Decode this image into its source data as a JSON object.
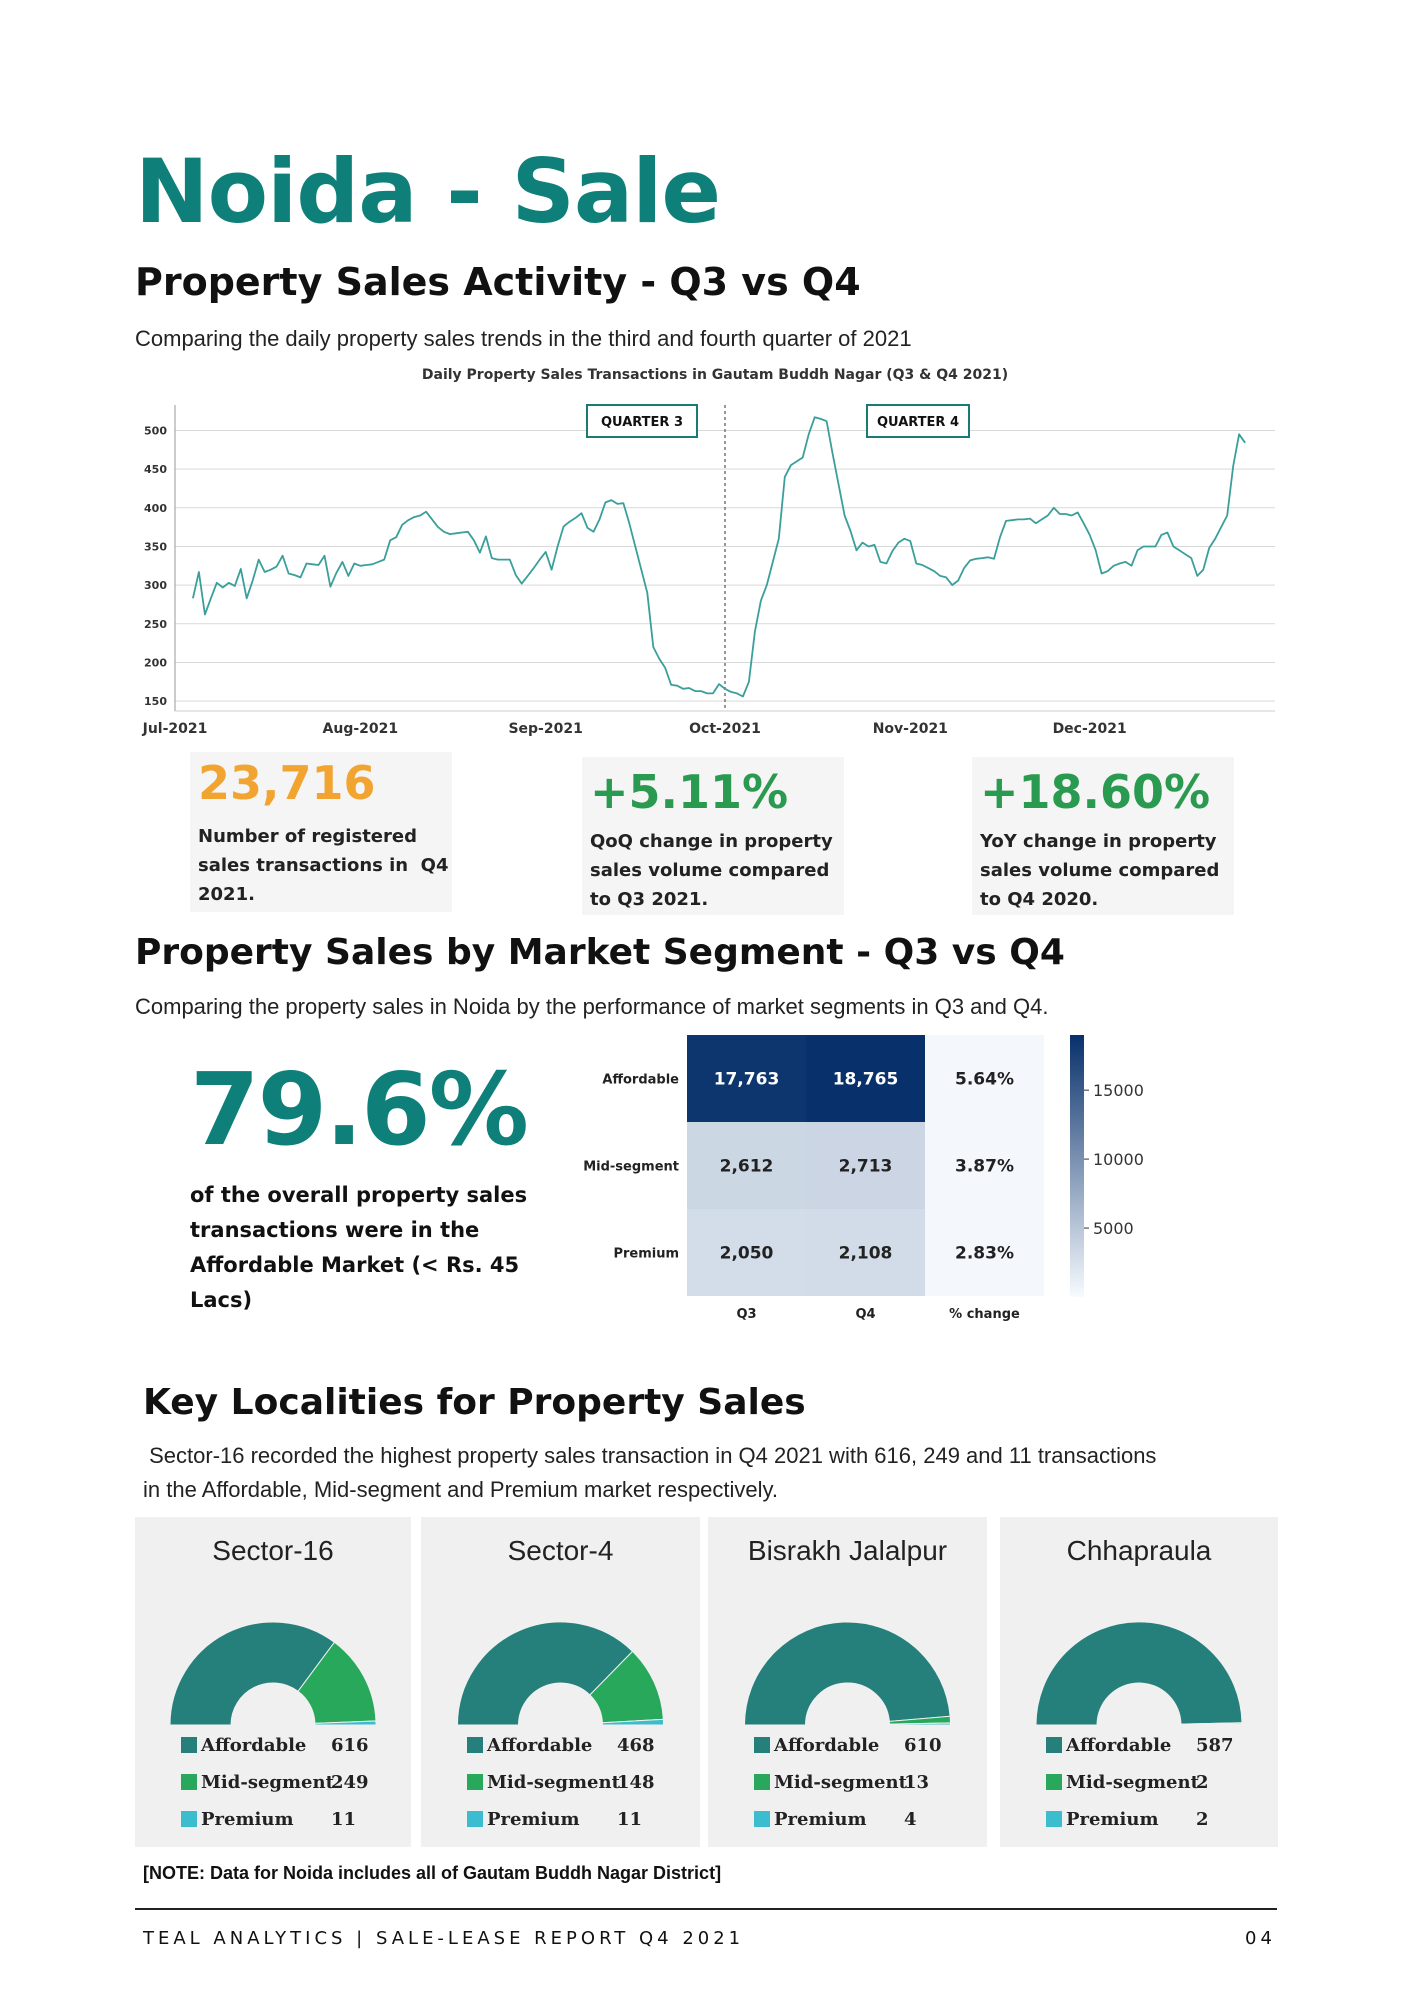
{
  "page": {
    "title": "Noida - Sale",
    "footer_left": "TEAL ANALYTICS | SALE-LEASE REPORT Q4 2021",
    "footer_right": "04",
    "note": "[NOTE: Data for Noida includes all of Gautam Buddh Nagar District]"
  },
  "colors": {
    "teal": "#0e8079",
    "orange": "#f2a431",
    "green": "#2a9a50",
    "line": "#3a9f9a"
  },
  "section1": {
    "heading": "Property Sales Activity - Q3 vs Q4",
    "subtitle": "Comparing the daily property sales trends in the third and fourth quarter of 2021"
  },
  "chart_data": [
    {
      "type": "line",
      "title": "Daily Property Sales Transactions in Gautam Buddh Nagar (Q3 & Q4 2021)",
      "xlabel": "",
      "ylabel": "",
      "x_ticks": [
        "Jul-2021",
        "Aug-2021",
        "Sep-2021",
        "Oct-2021",
        "Nov-2021",
        "Dec-2021"
      ],
      "y_ticks": [
        150,
        200,
        250,
        300,
        350,
        400,
        450,
        500
      ],
      "ylim": [
        145,
        520
      ],
      "grid": true,
      "annotations": [
        "QUARTER 3",
        "QUARTER 4"
      ],
      "divider_x": 92,
      "x": [
        3,
        4,
        5,
        6,
        7,
        8,
        9,
        10,
        11,
        12,
        13,
        14,
        15,
        16,
        17,
        18,
        19,
        20,
        21,
        22,
        23,
        24,
        25,
        26,
        27,
        28,
        29,
        30,
        31,
        32,
        33,
        34,
        35,
        36,
        37,
        38,
        39,
        40,
        41,
        42,
        43,
        44,
        45,
        46,
        47,
        48,
        49,
        50,
        51,
        52,
        53,
        54,
        55,
        56,
        57,
        58,
        59,
        60,
        61,
        62,
        63,
        64,
        65,
        66,
        67,
        68,
        69,
        70,
        71,
        72,
        73,
        74,
        75,
        76,
        77,
        78,
        79,
        80,
        81,
        82,
        83,
        84,
        85,
        86,
        87,
        88,
        89,
        90,
        91,
        92,
        93,
        94,
        95,
        96,
        97,
        98,
        99,
        100,
        101,
        102,
        103,
        104,
        105,
        106,
        107,
        108,
        109,
        110,
        111,
        112,
        113,
        114,
        115,
        116,
        117,
        118,
        119,
        120,
        121,
        122,
        123,
        124,
        125,
        126,
        127,
        128,
        129,
        130,
        131,
        132,
        133,
        134,
        135,
        136,
        137,
        138,
        139,
        140,
        141,
        142,
        143,
        144,
        145,
        146,
        147,
        148,
        149,
        150,
        151,
        152,
        153,
        154,
        155,
        156,
        157,
        158,
        159,
        160,
        161,
        162,
        163,
        164,
        165,
        166,
        167,
        168,
        169,
        170,
        171,
        172,
        173,
        174,
        175,
        176,
        177,
        178,
        179,
        180,
        181,
        182,
        183,
        184
      ],
      "series": [
        {
          "values": [
            283,
            317,
            262,
            283,
            303,
            297,
            303,
            299,
            321,
            283,
            306,
            333,
            317,
            320,
            324,
            338,
            315,
            313,
            310,
            328,
            327,
            326,
            338,
            298,
            316,
            330,
            312,
            328,
            325,
            326,
            327,
            330,
            333,
            358,
            362,
            378,
            384,
            388,
            390,
            395,
            385,
            375,
            369,
            366,
            367,
            368,
            369,
            358,
            342,
            363,
            335,
            333,
            333,
            333,
            313,
            302,
            312,
            322,
            333,
            343,
            320,
            350,
            376,
            382,
            387,
            393,
            374,
            369,
            385,
            407,
            410,
            405,
            406,
            380,
            350,
            320,
            290,
            220,
            205,
            193,
            171,
            170,
            166,
            167,
            163,
            163,
            160,
            160,
            172,
            166,
            162,
            160,
            156,
            175,
            240,
            280,
            300,
            330,
            360,
            440,
            455,
            460,
            465,
            495,
            517,
            515,
            512,
            470,
            430,
            390,
            370,
            345,
            355,
            350,
            352,
            330,
            328,
            344,
            355,
            360,
            357,
            328,
            326,
            322,
            318,
            312,
            310,
            300,
            306,
            322,
            332,
            334,
            335,
            336,
            334,
            362,
            383,
            384,
            385,
            385,
            386,
            380,
            385,
            390,
            400,
            392,
            392,
            390,
            394,
            380,
            365,
            345,
            315,
            318,
            325,
            328,
            330,
            325,
            345,
            350,
            350,
            350,
            365,
            368,
            350,
            345,
            340,
            335,
            312,
            320,
            348,
            360,
            375,
            390,
            454,
            495,
            484
          ]
        }
      ]
    },
    {
      "type": "heatmap",
      "rows": [
        "Affordable",
        "Mid-segment",
        "Premium"
      ],
      "columns": [
        "Q3",
        "Q4",
        "% change"
      ],
      "values": [
        [
          17763,
          18765,
          5.64
        ],
        [
          2612,
          2713,
          3.87
        ],
        [
          2050,
          2108,
          2.83
        ]
      ],
      "cell_labels": [
        [
          "17,763",
          "18,765",
          "5.64%"
        ],
        [
          "2,612",
          "2,713",
          "3.87%"
        ],
        [
          "2,050",
          "2,108",
          "2.83%"
        ]
      ],
      "colorbar_ticks": [
        "15000",
        "10000",
        "5000"
      ],
      "colorbar_range": [
        0,
        19000
      ]
    },
    {
      "type": "pie",
      "title": "Sector-16",
      "labels": [
        "Affordable",
        "Mid-segment",
        "Premium"
      ],
      "values": [
        616,
        249,
        11
      ],
      "display": [
        "616",
        "249",
        "11"
      ]
    },
    {
      "type": "pie",
      "title": "Sector-4",
      "labels": [
        "Affordable",
        "Mid-segment",
        "Premium"
      ],
      "values": [
        468,
        148,
        11
      ],
      "display": [
        "468",
        "148",
        "11"
      ]
    },
    {
      "type": "pie",
      "title": "Bisrakh Jalalpur",
      "labels": [
        "Affordable",
        "Mid-segment",
        "Premium"
      ],
      "values": [
        610,
        13,
        4
      ],
      "display": [
        "610",
        "13",
        "4"
      ]
    },
    {
      "type": "pie",
      "title": "Chhapraula",
      "labels": [
        "Affordable",
        "Mid-segment",
        "Premium"
      ],
      "values": [
        587,
        2,
        2
      ],
      "display": [
        "587",
        "2",
        "2"
      ]
    }
  ],
  "stats": [
    {
      "value": "23,716",
      "desc": [
        "Number of registered",
        "sales transactions in  Q4",
        "2021."
      ],
      "color": "#f2a431"
    },
    {
      "value": "+5.11%",
      "desc": [
        "QoQ change in property",
        "sales volume compared",
        "to Q3 2021."
      ],
      "color": "#2a9a50"
    },
    {
      "value": "+18.60%",
      "desc": [
        "YoY change in property",
        "sales volume compared",
        "to Q4 2020."
      ],
      "color": "#2a9a50"
    }
  ],
  "section2": {
    "heading": "Property Sales by Market Segment - Q3 vs Q4",
    "subtitle": "Comparing the property sales in Noida by the performance of market segments in Q3 and Q4.",
    "big_pct": "79.6%",
    "pct_desc": [
      "of the overall property sales",
      "transactions were in the",
      "Affordable Market (< Rs. 45",
      "Lacs)"
    ]
  },
  "section3": {
    "heading": "Key Localities for Property Sales",
    "subtitle_lines": [
      " Sector-16 recorded the highest property sales transaction in Q4 2021 with 616, 249 and 11 transactions",
      "in the Affordable, Mid-segment and Premium market respectively."
    ],
    "legend_colors": [
      "#257f7b",
      "#27a85a",
      "#3bbccf"
    ]
  }
}
